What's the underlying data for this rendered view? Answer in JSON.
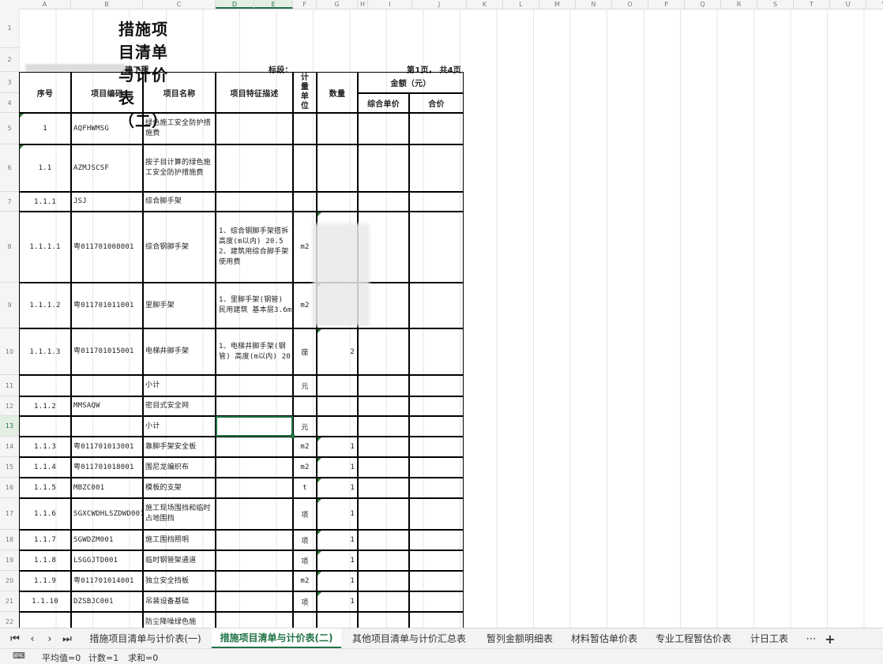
{
  "columns": [
    "A",
    "B",
    "C",
    "D",
    "E",
    "F",
    "G",
    "H",
    "I",
    "J",
    "K",
    "L",
    "M",
    "N",
    "O",
    "P",
    "Q",
    "R",
    "S",
    "T",
    "U",
    "V"
  ],
  "rows": [
    "1",
    "2",
    "3",
    "4",
    "5",
    "6",
    "7",
    "8",
    "9",
    "10",
    "11",
    "12",
    "13",
    "14",
    "15",
    "16",
    "17",
    "18",
    "19",
    "20",
    "21",
    "22"
  ],
  "doc": {
    "title": "措施项目清单与计价表（二）",
    "project_suffix": "建工程",
    "section_label": "标段：",
    "page_info": "第1页， 共4页"
  },
  "headers": {
    "seq": "序号",
    "code": "项目编码",
    "name": "项目名称",
    "desc": "项目特征描述",
    "unit": "计量单位",
    "qty": "数量",
    "amount": "金额（元）",
    "unit_price": "综合单价",
    "total": "合价"
  },
  "items": [
    {
      "seq": "1",
      "code": "AQFHWMSG",
      "name": "绿色施工安全防护措施费",
      "desc": "",
      "unit": "",
      "qty": ""
    },
    {
      "seq": "1.1",
      "code": "AZMJSCSF",
      "name": "按子目计算的绿色施工安全防护措施费",
      "desc": "",
      "unit": "",
      "qty": ""
    },
    {
      "seq": "1.1.1",
      "code": "JSJ",
      "name": "综合脚手架",
      "desc": "",
      "unit": "",
      "qty": ""
    },
    {
      "seq": "1.1.1.1",
      "code": "粤011701008001",
      "name": "综合钢脚手架",
      "desc": "1、综合钢脚手架搭拆 高度(m以内) 20.5\n2、建筑用综合脚手架使用费",
      "unit": "m2",
      "qty": ""
    },
    {
      "seq": "1.1.1.2",
      "code": "粤011701011001",
      "name": "里脚手架",
      "desc": "1、里脚手架(钢管) 民用建筑 基本层3.6m",
      "unit": "m2",
      "qty": ""
    },
    {
      "seq": "1.1.1.3",
      "code": "粤011701015001",
      "name": "电梯井脚手架",
      "desc": "1、电梯井脚手架(钢管) 高度(m以内) 20",
      "unit": "座",
      "qty": "2"
    },
    {
      "seq": "",
      "code": "",
      "name": "小计",
      "desc": "",
      "unit": "元",
      "qty": ""
    },
    {
      "seq": "1.1.2",
      "code": "MMSAQW",
      "name": "密目式安全网",
      "desc": "",
      "unit": "",
      "qty": ""
    },
    {
      "seq": "",
      "code": "",
      "name": "小计",
      "desc": "",
      "unit": "元",
      "qty": ""
    },
    {
      "seq": "1.1.3",
      "code": "粤011701013001",
      "name": "靠脚手架安全板",
      "desc": "",
      "unit": "m2",
      "qty": "1"
    },
    {
      "seq": "1.1.4",
      "code": "粤011701018001",
      "name": "围尼龙编织布",
      "desc": "",
      "unit": "m2",
      "qty": "1"
    },
    {
      "seq": "1.1.5",
      "code": "MBZC001",
      "name": "模板的支架",
      "desc": "",
      "unit": "t",
      "qty": "1"
    },
    {
      "seq": "1.1.6",
      "code": "SGXCWDHLSZDWD001",
      "name": "施工现场围挡和临时占地围挡",
      "desc": "",
      "unit": "项",
      "qty": "1"
    },
    {
      "seq": "1.1.7",
      "code": "SGWDZM001",
      "name": "施工围挡照明",
      "desc": "",
      "unit": "项",
      "qty": "1"
    },
    {
      "seq": "1.1.8",
      "code": "LSGGJTD001",
      "name": "临时钢管架通道",
      "desc": "",
      "unit": "项",
      "qty": "1"
    },
    {
      "seq": "1.1.9",
      "code": "粤011701014001",
      "name": "独立安全挡板",
      "desc": "",
      "unit": "m2",
      "qty": "1"
    },
    {
      "seq": "1.1.10",
      "code": "DZSBJC001",
      "name": "吊装设备基础",
      "desc": "",
      "unit": "项",
      "qty": "1"
    },
    {
      "seq": "",
      "code": "",
      "name": "防尘降噪绿色施",
      "desc": "",
      "unit": "",
      "qty": ""
    }
  ],
  "tabs": [
    "措施项目清单与计价表(一)",
    "措施项目清单与计价表(二)",
    "其他项目清单与计价汇总表",
    "暂列金额明细表",
    "材料暂估单价表",
    "专业工程暂估价表",
    "计日工表"
  ],
  "active_tab": 1,
  "status": {
    "average": "平均值=0",
    "count": "计数=1",
    "sum": "求和=0"
  }
}
